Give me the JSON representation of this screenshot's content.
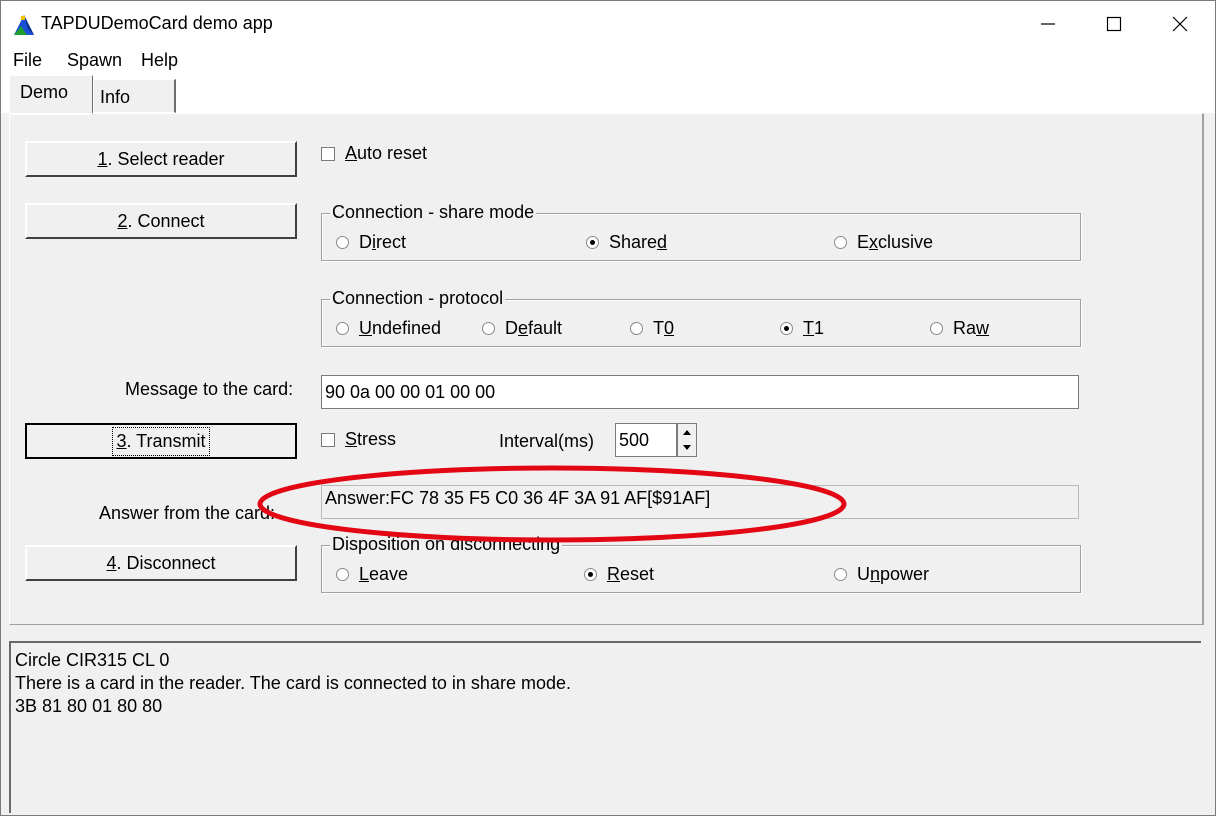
{
  "window": {
    "title": "TAPDUDemoCard demo app",
    "controls": {
      "minimize": "—",
      "maximize": "☐",
      "close": "✕"
    }
  },
  "menu": {
    "file": "File",
    "spawn": "Spawn",
    "help": "Help"
  },
  "tabs": {
    "demo": "Demo",
    "info": "Info"
  },
  "buttons": {
    "select_reader": {
      "prefix": "1",
      "rest": ". Select reader"
    },
    "connect": {
      "prefix": "2",
      "rest": ". Connect"
    },
    "transmit": {
      "prefix": "3",
      "rest": ". Transmit"
    },
    "disconnect": {
      "prefix": "4",
      "rest": ". Disconnect"
    }
  },
  "auto_reset": {
    "a": "A",
    "rest": "uto reset",
    "checked": false
  },
  "share_mode": {
    "legend": "Connection - share mode",
    "direct": {
      "pre": "D",
      "u": "i",
      "post": "rect",
      "selected": false
    },
    "shared": {
      "pre": "Share",
      "u": "d",
      "post": "",
      "selected": true
    },
    "exclusive": {
      "pre": "E",
      "u": "x",
      "post": "clusive",
      "selected": false
    }
  },
  "protocol": {
    "legend": "Connection - protocol",
    "undefined": {
      "pre": "",
      "u": "U",
      "post": "ndefined",
      "selected": false
    },
    "default": {
      "pre": "D",
      "u": "e",
      "post": "fault",
      "selected": false
    },
    "t0": {
      "pre": "T",
      "u": "0",
      "post": "",
      "selected": false
    },
    "t1": {
      "pre": "",
      "u": "T",
      "post": "1",
      "selected": true
    },
    "raw": {
      "pre": "Ra",
      "u": "w",
      "post": "",
      "selected": false
    }
  },
  "message": {
    "label": "Message to the card:",
    "value": "90 0a 00 00 01 00 00"
  },
  "stress": {
    "s": "S",
    "rest": "tress",
    "checked": false
  },
  "interval": {
    "label": "Interval(ms)",
    "value": "500"
  },
  "answer": {
    "label": "Answer from the card:",
    "value": "Answer:FC 78 35 F5 C0 36 4F 3A 91 AF[$91AF]"
  },
  "disposition": {
    "legend": "Disposition on disconnecting",
    "leave": {
      "pre": "",
      "u": "L",
      "post": "eave",
      "selected": false
    },
    "reset": {
      "pre": "",
      "u": "R",
      "post": "eset",
      "selected": true
    },
    "unpower": {
      "pre": "U",
      "u": "n",
      "post": "power",
      "selected": false
    }
  },
  "log": [
    "Circle CIR315 CL 0",
    "There is a card in the reader. The card is connected to in share mode.",
    "3B 81 80 01 80 80"
  ],
  "colors": {
    "annotation": "#e30613",
    "face": "#f0f0f0"
  }
}
